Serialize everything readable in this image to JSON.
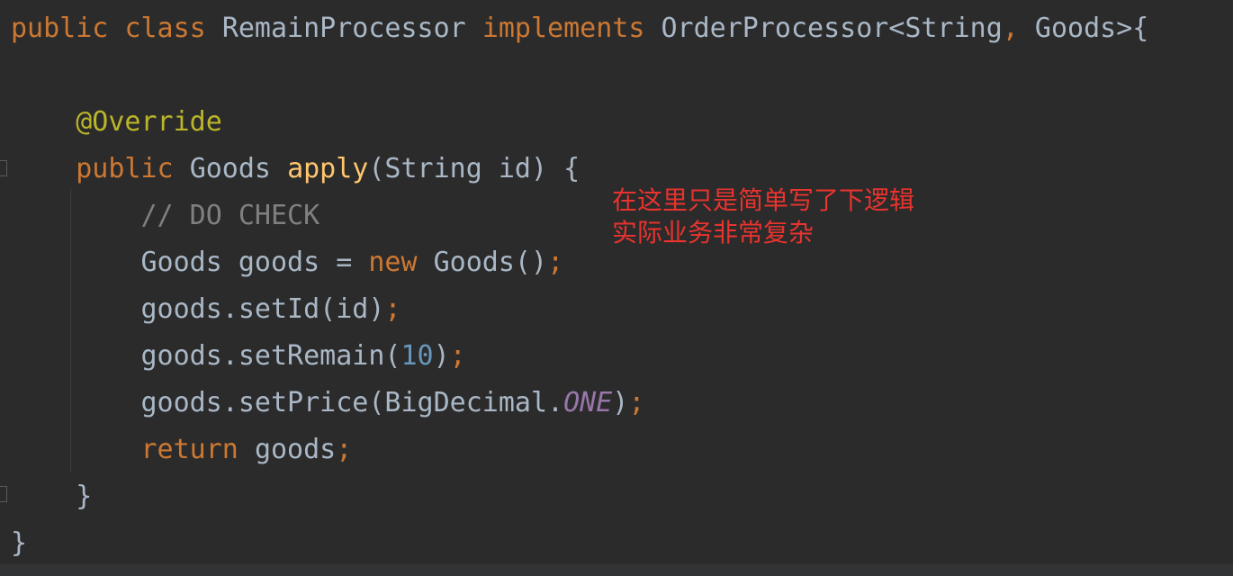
{
  "code": {
    "line1": {
      "public": "public",
      "class": "class",
      "name": "RemainProcessor",
      "implements": "implements",
      "iface": "OrderProcessor<String",
      "comma": ",",
      "type2": "Goods>{"
    },
    "line3": {
      "annotation": "@Override"
    },
    "line4": {
      "public": "public",
      "ret": "Goods",
      "method": "apply",
      "params": "(String id) {"
    },
    "line5": {
      "comment": "// DO CHECK"
    },
    "line6": {
      "decl": "Goods goods = ",
      "new": "new",
      "ctor": "Goods()",
      "semi": ";"
    },
    "line7": {
      "call": "goods.setId(id)",
      "semi": ";"
    },
    "line8": {
      "call": "goods.setRemain(",
      "num": "10",
      "close": ")",
      "semi": ";"
    },
    "line9": {
      "call": "goods.setPrice(BigDecimal.",
      "field": "ONE",
      "close": ")",
      "semi": ";"
    },
    "line10": {
      "return": "return",
      "value": "goods",
      "semi": ";"
    },
    "line11": {
      "brace": "}"
    },
    "line12": {
      "brace": "}"
    }
  },
  "annotation_note": {
    "line1": "在这里只是简单写了下逻辑",
    "line2": "实际业务非常复杂"
  },
  "colors": {
    "background": "#2b2b2b",
    "keyword": "#cc7832",
    "text": "#a9b7c6",
    "annotation": "#bbb529",
    "function": "#ffc66d",
    "comment": "#808080",
    "number": "#6897bb",
    "static_field": "#9876aa",
    "note": "#e8332e"
  }
}
